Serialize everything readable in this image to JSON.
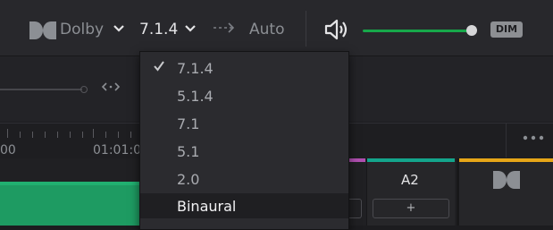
{
  "toolbar": {
    "format_label": "Dolby",
    "format_value": "7.1.4",
    "renderer_label": "Auto",
    "dim_label": "DIM",
    "volume_level": 0.95
  },
  "timeline": {
    "timecode_1": "00",
    "timecode_2": "01:01:0"
  },
  "tracks": {
    "a2_label": "A2",
    "add_label": "+"
  },
  "dropdown": {
    "items": [
      {
        "label": "7.1.4",
        "checked": true
      },
      {
        "label": "5.1.4",
        "checked": false
      },
      {
        "label": "7.1",
        "checked": false
      },
      {
        "label": "5.1",
        "checked": false
      },
      {
        "label": "2.0",
        "checked": false
      },
      {
        "label": "Binaural",
        "checked": false
      }
    ]
  },
  "colors": {
    "volume_accent": "#17a84a",
    "clip_green": "#1e9b62",
    "track_a2": "#14a58c",
    "track_dolby": "#e6a618",
    "track_pink": "#b04fb0"
  }
}
